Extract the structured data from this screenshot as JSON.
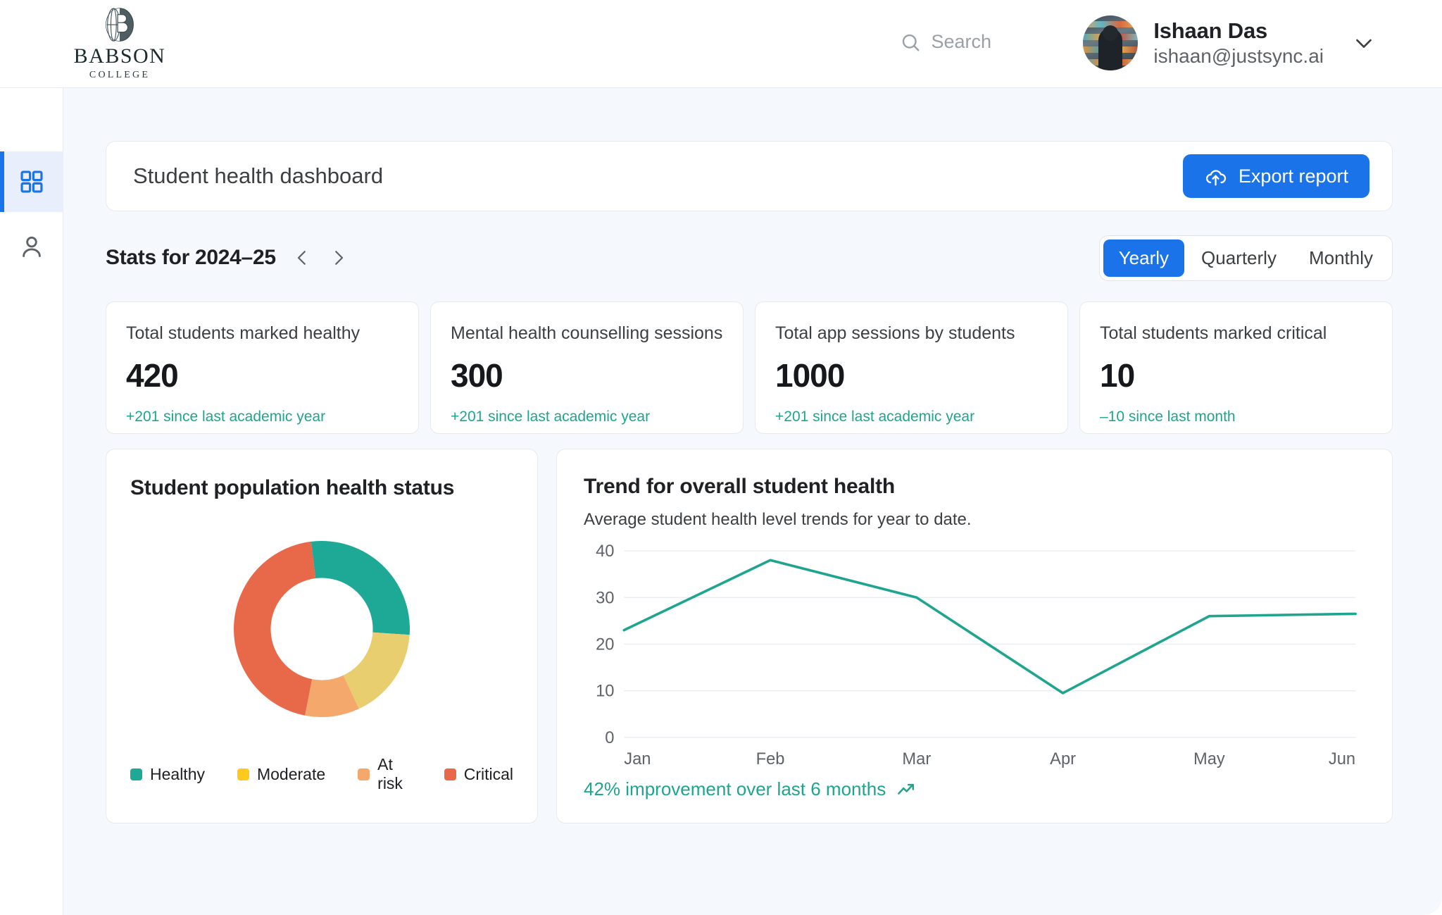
{
  "brand": {
    "name": "BABSON",
    "sub": "COLLEGE",
    "logo_icon": "babson-globe-b-icon"
  },
  "header": {
    "search_label": "Search",
    "search_icon": "search-icon",
    "chevron_icon": "chevron-down-icon",
    "user": {
      "name": "Ishaan Das",
      "email": "ishaan@justsync.ai",
      "avatar_icon": "user-avatar"
    }
  },
  "sidebar": {
    "items": [
      {
        "name": "dashboard",
        "icon": "grid-dashboard-icon",
        "active": true
      },
      {
        "name": "profile",
        "icon": "person-icon",
        "active": false
      }
    ]
  },
  "page": {
    "title": "Student health dashboard",
    "export_label": "Export report",
    "export_icon": "cloud-upload-icon"
  },
  "stats_header": {
    "title": "Stats for 2024–25",
    "prev_icon": "chevron-left-icon",
    "next_icon": "chevron-right-icon",
    "periods": [
      {
        "label": "Yearly",
        "active": true
      },
      {
        "label": "Quarterly",
        "active": false
      },
      {
        "label": "Monthly",
        "active": false
      }
    ]
  },
  "stat_cards": [
    {
      "label": "Total students marked healthy",
      "value": "420",
      "delta": "+201 since last academic year"
    },
    {
      "label": "Mental health counselling sessions",
      "value": "300",
      "delta": "+201 since last academic year"
    },
    {
      "label": "Total app sessions  by students",
      "value": "1000",
      "delta": "+201 since last academic year"
    },
    {
      "label": "Total students marked critical",
      "value": "10",
      "delta": "–10 since last month"
    }
  ],
  "colors": {
    "accent_blue": "#1a73e8",
    "teal": "#1fa58f",
    "healthy": "#1ea896",
    "moderate": "#ffc91e",
    "at_risk": "#f5a86b",
    "critical": "#e8694a",
    "canvas": "#f5f9fd",
    "grid": "#e9edf2"
  },
  "donut_panel": {
    "title": "Student population health status"
  },
  "trend_panel": {
    "title": "Trend for overall  student health",
    "subtitle": "Average student health level trends for year to date.",
    "footer": "42% improvement over last 6 months",
    "footer_icon": "trending-up-icon"
  },
  "chart_data": [
    {
      "type": "pie",
      "title": "Student population health status",
      "legend_position": "bottom",
      "labels": [
        "Healthy",
        "Moderate",
        "At risk",
        "Critical"
      ],
      "values": [
        28,
        17,
        10,
        45
      ],
      "colors": [
        "#1ea896",
        "#e8ce6e",
        "#f5a86b",
        "#e8694a"
      ],
      "legend_colors": [
        "#1ea896",
        "#ffc91e",
        "#f5a86b",
        "#e8694a"
      ],
      "donut_hole_ratio": 0.58,
      "start_angle_deg": -7
    },
    {
      "type": "line",
      "title": "Trend for overall  student health",
      "subtitle": "Average student health level trends for year to date.",
      "categories": [
        "Jan",
        "Feb",
        "Mar",
        "Apr",
        "May",
        "Jun"
      ],
      "series": [
        {
          "name": "Average student health level",
          "values": [
            23,
            38,
            30,
            9.5,
            26,
            26.5
          ]
        }
      ],
      "xlabel": "",
      "ylabel": "",
      "ylim": [
        0,
        40
      ],
      "yticks": [
        0,
        10,
        20,
        30,
        40
      ],
      "grid": true,
      "line_color": "#1fa58f",
      "annotation": "42% improvement over last 6 months"
    }
  ]
}
